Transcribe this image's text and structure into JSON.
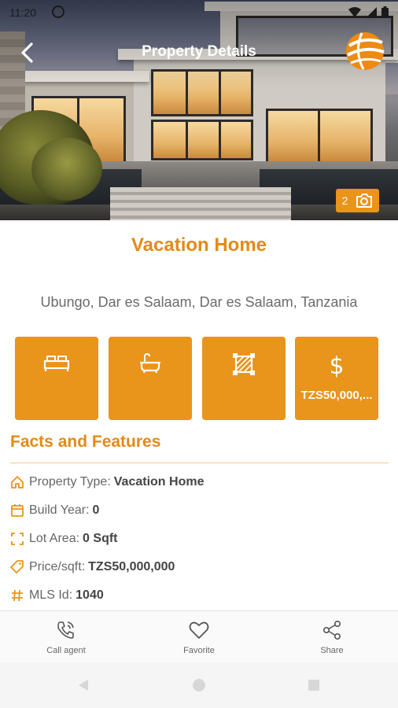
{
  "status_bar": {
    "time": "11:20"
  },
  "header": {
    "title": "Property Details",
    "back_icon": "arrow-back-icon",
    "logo_icon": "globe-logo-icon"
  },
  "gallery": {
    "photo_count": "2",
    "camera_icon": "camera-icon"
  },
  "property": {
    "title": "Vacation Home",
    "address": "Ubungo, Dar es Salaam, Dar es Salaam, Tanzania"
  },
  "tiles": [
    {
      "icon": "bed-icon",
      "value": ""
    },
    {
      "icon": "bathtub-icon",
      "value": ""
    },
    {
      "icon": "area-icon",
      "value": ""
    },
    {
      "icon": "dollar-icon",
      "value": "TZS50,000,..."
    }
  ],
  "facts": {
    "heading": "Facts and Features",
    "items": [
      {
        "icon": "home-icon",
        "label": "Property Type:",
        "value": "Vacation Home"
      },
      {
        "icon": "calendar-icon",
        "label": "Build Year:",
        "value": "0"
      },
      {
        "icon": "frame-icon",
        "label": "Lot Area:",
        "value": "0 Sqft"
      },
      {
        "icon": "tag-icon",
        "label": "Price/sqft:",
        "value": "TZS50,000,000"
      },
      {
        "icon": "hash-icon",
        "label": "MLS Id:",
        "value": "1040"
      }
    ]
  },
  "bottom_actions": [
    {
      "icon": "phone-icon",
      "label": "Call agent"
    },
    {
      "icon": "heart-icon",
      "label": "Favorite"
    },
    {
      "icon": "share-icon",
      "label": "Share"
    }
  ],
  "colors": {
    "accent": "#e9941a",
    "accent_text": "#e38a16"
  }
}
